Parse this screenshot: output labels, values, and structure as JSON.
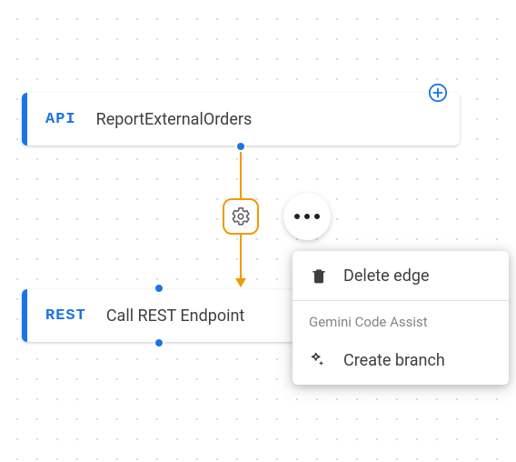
{
  "nodes": {
    "api": {
      "tag": "API",
      "title": "ReportExternalOrders"
    },
    "rest": {
      "tag": "REST",
      "title": "Call REST Endpoint"
    }
  },
  "menu": {
    "delete_label": "Delete edge",
    "section_header": "Gemini Code Assist",
    "create_branch_label": "Create branch"
  }
}
